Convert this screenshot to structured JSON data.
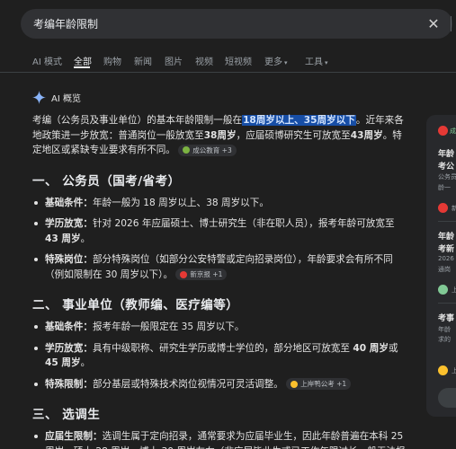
{
  "search": {
    "query": "考编年龄限制",
    "clear_icon": "close-icon"
  },
  "tabs": [
    {
      "label": "AI 模式"
    },
    {
      "label": "全部",
      "active": true
    },
    {
      "label": "购物"
    },
    {
      "label": "新闻"
    },
    {
      "label": "图片"
    },
    {
      "label": "视频"
    },
    {
      "label": "短视频"
    },
    {
      "label": "更多"
    },
    {
      "label": "工具"
    }
  ],
  "ai_overview": {
    "label": "AI 概览",
    "intro_1": "考编（公务员及事业单位）的基本年龄限制一般在",
    "intro_hl": "18周岁以上、35周岁以下",
    "intro_2": "。近年来各地政策进一步放宽：普通岗位一般放宽至",
    "intro_b1": "38周岁",
    "intro_3": "，应届硕博研究生可放宽至",
    "intro_b2": "43周岁",
    "intro_4": "。特定地区或紧缺专业要求有所不同。",
    "intro_chip": "成公教育 +3"
  },
  "sections": [
    {
      "title": "一、 公务员（国考/省考）",
      "items": [
        {
          "term": "基础条件：",
          "text": "年龄一般为 18 周岁以上、38 周岁以下。"
        },
        {
          "term": "学历放宽：",
          "text": "针对 2026 年应届硕士、博士研究生（非在职人员），报考年龄可放宽至 ",
          "bold_end": "43 周岁",
          "tail": "。"
        },
        {
          "term": "特殊岗位：",
          "text": "部分特殊岗位（如部分公安特警或定向招录岗位），年龄要求会有所不同（例如限制在 30 周岁以下）。",
          "chip": "新京报 +1"
        }
      ]
    },
    {
      "title": "二、 事业单位（教师编、医疗编等）",
      "items": [
        {
          "term": "基础条件：",
          "text": "报考年龄一般限定在 35 周岁以下。"
        },
        {
          "term": "学历放宽：",
          "text": "具有中级职称、研究生学历或博士学位的，部分地区可放宽至 ",
          "bold_end": "40 周岁",
          "mid": "或 ",
          "bold_end2": "45 周岁",
          "tail": "。"
        },
        {
          "term": "特殊限制：",
          "text": "部分基层或特殊技术岗位视情况可灵活调整。",
          "chip": "上岸鸭公考 +1"
        }
      ]
    },
    {
      "title": "三、 选调生",
      "items": [
        {
          "term": "应届生限制：",
          "text": "选调生属于定向招录，通常要求为应届毕业生，因此年龄普遍在本科 25 周岁、硕士 28 周岁、博士 30 周岁左右（非应届毕业生或已工作年限过长一般无法报"
        }
      ]
    }
  ],
  "side_panel": {
    "items": [
      {
        "text": "成"
      },
      {
        "text": "年龄"
      },
      {
        "text": "考公"
      },
      {
        "text": "公务员"
      },
      {
        "text": "龄一"
      },
      {
        "text": "新"
      },
      {
        "text": "年龄"
      },
      {
        "text": "考新"
      },
      {
        "text": "2026"
      },
      {
        "text": "通岗"
      },
      {
        "text": "上"
      },
      {
        "text": "考事"
      },
      {
        "text": "年龄"
      },
      {
        "text": "求的"
      },
      {
        "text": "上"
      }
    ]
  },
  "colors": {
    "background": "#1f1f1f",
    "highlight": "#174ea6",
    "chip_bg": "#303134"
  }
}
